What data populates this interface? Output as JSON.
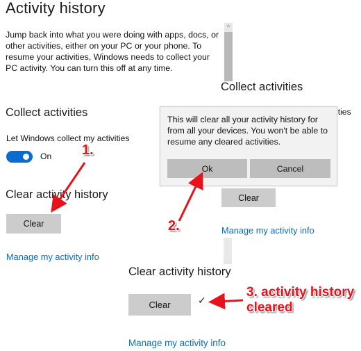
{
  "left_panel": {
    "title": "Activity history",
    "description": "Jump back into what you were doing with apps, docs, or other activities, either on your PC or your phone. To resume your activities, Windows needs to collect your PC activity. You can turn this off at any time.",
    "collect_heading": "Collect activities",
    "collect_label": "Let Windows collect my activities",
    "toggle_state": "On",
    "toggle_on": true,
    "clear_heading": "Clear activity history",
    "clear_button": "Clear",
    "manage_link": "Manage my activity info"
  },
  "middle_panel": {
    "collect_heading": "Collect activities",
    "partial_label": "ities",
    "scroll_up_glyph": "^",
    "clear_button": "Clear",
    "manage_link": "Manage my activity info"
  },
  "dialog": {
    "message": "This will clear all your activity history for from all your devices.  You won't be able to resume any cleared activities.",
    "ok_button": "Ok",
    "cancel_button": "Cancel"
  },
  "bottom_panel": {
    "clear_heading": "Clear activity history",
    "clear_button": "Clear",
    "check_glyph": "✓",
    "manage_link": "Manage my activity info"
  },
  "annotations": {
    "step1": "1.",
    "step2": "2.",
    "step3_line1": "3. activity history",
    "step3_line2": "cleared",
    "color": "#e8121c"
  },
  "colors": {
    "accent": "#0a6bd0",
    "link": "#0a6bc6",
    "button": "#cccccc",
    "dialog_button": "#bdbdbd"
  }
}
